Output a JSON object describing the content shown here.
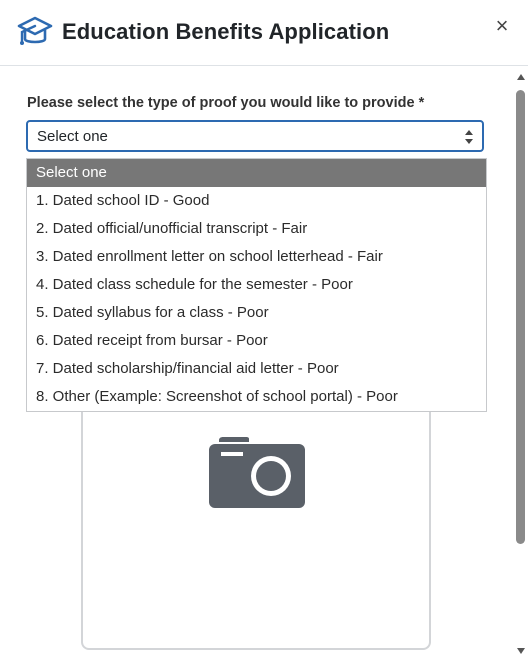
{
  "header": {
    "title": "Education Benefits Application",
    "close_label": "×",
    "logo_icon": "graduation-cap-icon",
    "accent_color": "#2d6ab1"
  },
  "form": {
    "proof_label": "Please select the type of proof you would like to provide *",
    "select_value": "Select one"
  },
  "dropdown": {
    "options": [
      "Select one",
      "1. Dated school ID - Good",
      "2. Dated official/unofficial transcript - Fair",
      "3. Dated enrollment letter on school letterhead - Fair",
      "4. Dated class schedule for the semester - Poor",
      "5. Dated syllabus for a class - Poor",
      "6. Dated receipt from bursar - Poor",
      "7. Dated scholarship/financial aid letter - Poor",
      "8. Other (Example: Screenshot of school portal) - Poor"
    ],
    "selected_index": 0
  },
  "upload": {
    "icon": "camera-icon"
  }
}
